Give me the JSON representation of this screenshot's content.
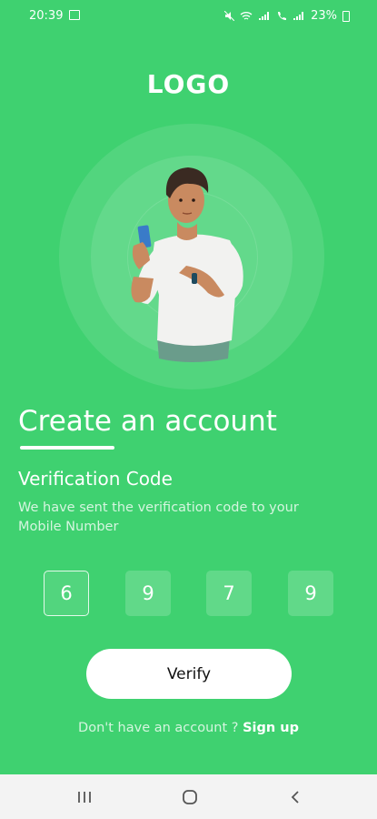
{
  "status_bar": {
    "time": "20:39",
    "battery": "23%",
    "icons": [
      "image-icon",
      "mute-icon",
      "wifi-icon",
      "signal-icon",
      "call-icon",
      "signal-icon",
      "battery-icon"
    ]
  },
  "logo": "LOGO",
  "title": {
    "part1": "Create",
    "part2": " an account"
  },
  "subtitle": "Verification Code",
  "description": "We have sent the  verification code to your Mobile Number",
  "code": {
    "digits": [
      "6",
      "9",
      "7",
      "9"
    ]
  },
  "verify_button": "Verify",
  "signup": {
    "prompt": "Don't have an account ? ",
    "link": "Sign up"
  },
  "colors": {
    "background": "#3fd170",
    "button_bg": "#ffffff",
    "navbar_bg": "#f3f3f3"
  },
  "illustration": "person-with-phone"
}
